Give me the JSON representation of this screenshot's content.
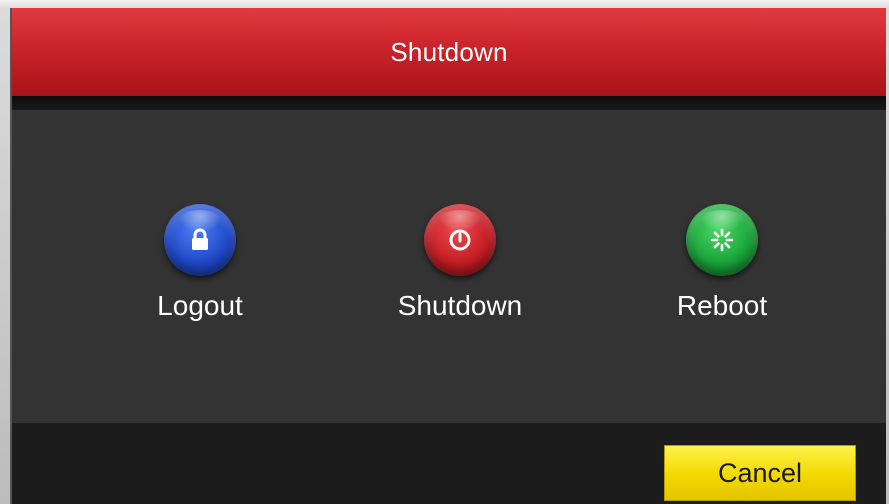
{
  "dialog": {
    "title": "Shutdown"
  },
  "options": [
    {
      "label": "Logout",
      "icon": "lock-icon",
      "color": "#1f48c9"
    },
    {
      "label": "Shutdown",
      "icon": "power-icon",
      "color": "#c41d24"
    },
    {
      "label": "Reboot",
      "icon": "restart-icon",
      "color": "#1aa43a"
    }
  ],
  "footer": {
    "cancel_label": "Cancel"
  },
  "colors": {
    "title_bar": "#c9242a",
    "body": "#333333",
    "cancel_button": "#f3d800"
  }
}
